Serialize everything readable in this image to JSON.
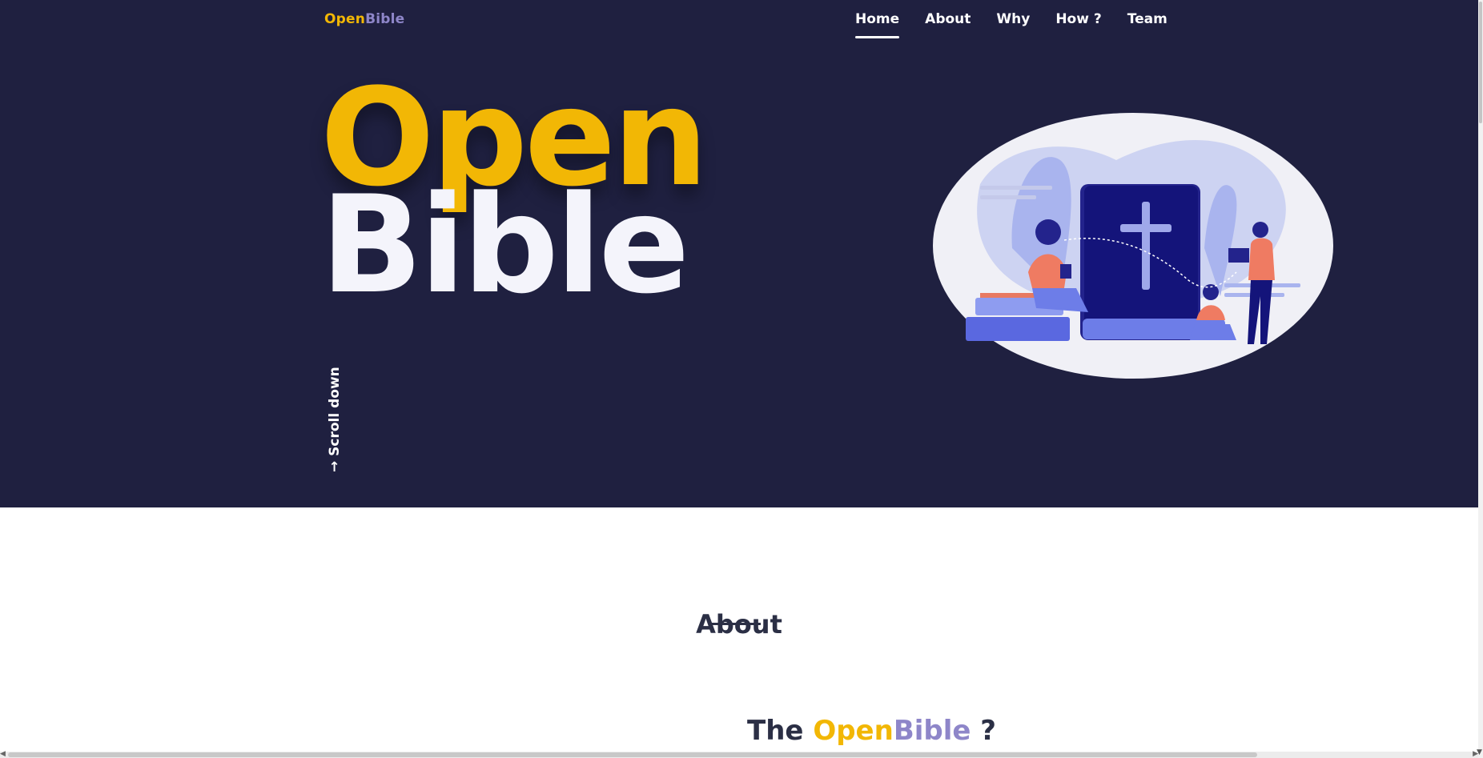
{
  "brand": {
    "open": "Open",
    "bible": "Bible"
  },
  "nav": {
    "items": [
      {
        "label": "Home",
        "active": true
      },
      {
        "label": "About",
        "active": false
      },
      {
        "label": "Why",
        "active": false
      },
      {
        "label": "How ?",
        "active": false
      },
      {
        "label": "Team",
        "active": false
      }
    ]
  },
  "hero": {
    "title_open": "Open",
    "title_bible": "Bible",
    "scroll_label": "→ Scroll down"
  },
  "about": {
    "title": "About",
    "subtitle_prefix": "The",
    "subtitle_open": "Open",
    "subtitle_bible": "Bible",
    "subtitle_suffix": "?"
  },
  "colors": {
    "hero_bg": "#1f2040",
    "accent_yellow": "#f2b705",
    "accent_purple": "#8e86c9",
    "text_dark": "#2b2f45"
  },
  "icons": {
    "illustration": "bible-reading-illustration",
    "scroll_arrow": "arrow-down-icon"
  }
}
